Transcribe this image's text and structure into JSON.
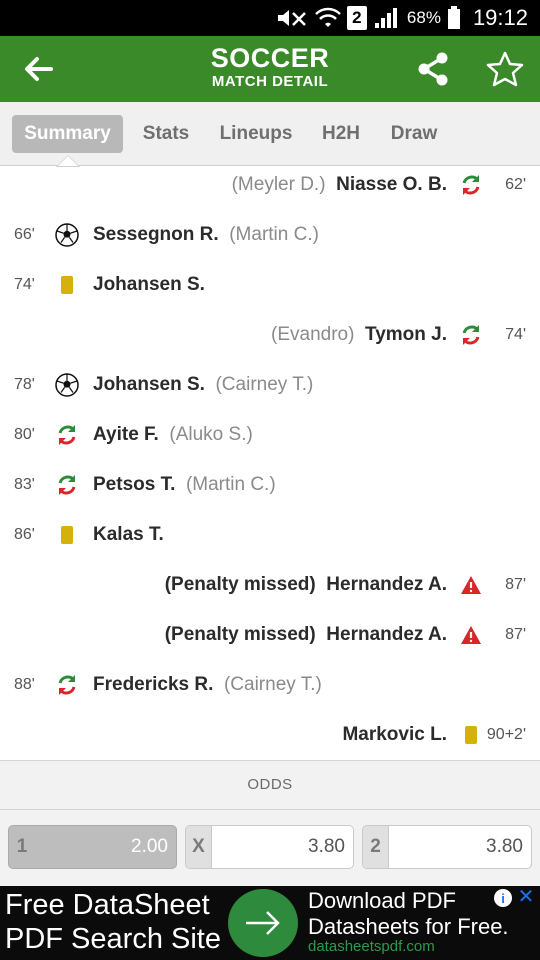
{
  "status_bar": {
    "battery_percent": "68%",
    "time": "19:12",
    "sim_slot": "2"
  },
  "header": {
    "title": "SOCCER",
    "subtitle": "MATCH DETAIL",
    "accent_color": "#3a8a2a"
  },
  "tabs": [
    {
      "label": "Summary",
      "active": true
    },
    {
      "label": "Stats",
      "active": false
    },
    {
      "label": "Lineups",
      "active": false
    },
    {
      "label": "H2H",
      "active": false
    },
    {
      "label": "Draw",
      "active": false
    }
  ],
  "events": [
    {
      "side": "away",
      "minute": "62'",
      "type": "substitution",
      "player": "Niasse O. B.",
      "detail": "(Meyler D.)"
    },
    {
      "side": "home",
      "minute": "66'",
      "type": "goal",
      "player": "Sessegnon R.",
      "detail": "(Martin C.)"
    },
    {
      "side": "home",
      "minute": "74'",
      "type": "yellow-card",
      "player": "Johansen S.",
      "detail": ""
    },
    {
      "side": "away",
      "minute": "74'",
      "type": "substitution",
      "player": "Tymon J.",
      "detail": "(Evandro)"
    },
    {
      "side": "home",
      "minute": "78'",
      "type": "goal",
      "player": "Johansen S.",
      "detail": "(Cairney T.)"
    },
    {
      "side": "home",
      "minute": "80'",
      "type": "substitution",
      "player": "Ayite F.",
      "detail": "(Aluko S.)"
    },
    {
      "side": "home",
      "minute": "83'",
      "type": "substitution",
      "player": "Petsos T.",
      "detail": "(Martin C.)"
    },
    {
      "side": "home",
      "minute": "86'",
      "type": "yellow-card",
      "player": "Kalas T.",
      "detail": ""
    },
    {
      "side": "away",
      "minute": "87'",
      "type": "penalty-missed",
      "player": "Hernandez A.",
      "detail": "(Penalty missed)"
    },
    {
      "side": "away",
      "minute": "87'",
      "type": "penalty-missed",
      "player": "Hernandez A.",
      "detail": "(Penalty missed)"
    },
    {
      "side": "home",
      "minute": "88'",
      "type": "substitution",
      "player": "Fredericks R.",
      "detail": "(Cairney T.)"
    },
    {
      "side": "away",
      "minute": "90+2'",
      "type": "yellow-card",
      "player": "Markovic L.",
      "detail": ""
    }
  ],
  "odds": {
    "heading": "ODDS",
    "options": [
      {
        "label": "1",
        "value": "2.00",
        "selected": true
      },
      {
        "label": "X",
        "value": "3.80",
        "selected": false
      },
      {
        "label": "2",
        "value": "3.80",
        "selected": false
      }
    ]
  },
  "ad": {
    "left_line1": "Free DataSheet",
    "left_line2": "PDF Search Site",
    "right_line1": "Download PDF",
    "right_line2": "Datasheets for Free.",
    "url": "datasheetspdf.com"
  }
}
